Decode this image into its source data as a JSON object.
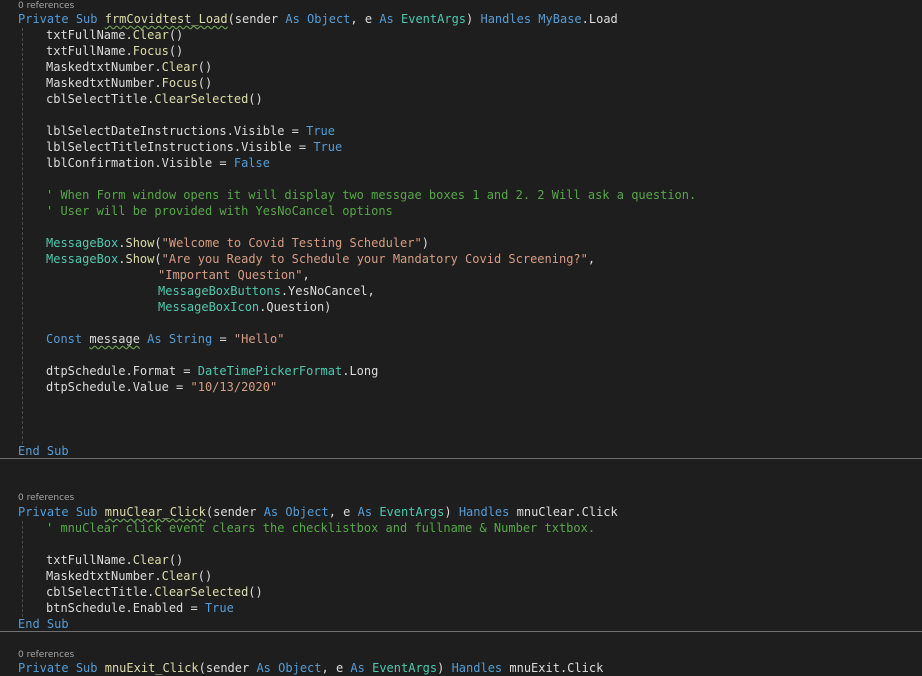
{
  "lenses": {
    "load": "0 references",
    "clear": "0 references",
    "exit": "0 references"
  },
  "load_sub": {
    "kw_private": "Private",
    "kw_sub": "Sub",
    "name": "frmCovidtest_Load",
    "p1": "(sender ",
    "kw_as1": "As",
    "ty_object": "Object",
    "p2": ", e ",
    "kw_as2": "As",
    "ty_eventargs": "EventArgs",
    "p3": ") ",
    "kw_handles": "Handles",
    "kw_mybase": "MyBase",
    "p4": ".Load"
  },
  "load_body": {
    "l1_obj": "txtFullName.",
    "l1_fn": "Clear",
    "l1_end": "()",
    "l2_obj": "txtFullName.",
    "l2_fn": "Focus",
    "l2_end": "()",
    "l3_obj": "MaskedtxtNumber.",
    "l3_fn": "Clear",
    "l3_end": "()",
    "l4_obj": "MaskedtxtNumber.",
    "l4_fn": "Focus",
    "l4_end": "()",
    "l5_obj": "cblSelectTitle.",
    "l5_fn": "ClearSelected",
    "l5_end": "()",
    "l6_text": "lblSelectDateInstructions.Visible = ",
    "l6_val": "True",
    "l7_text": "lblSelectTitleInstructions.Visible = ",
    "l7_val": "True",
    "l8_text": "lblConfirmation.Visible = ",
    "l8_val": "False",
    "comment1": "' When Form window opens it will display two messgae boxes 1 and 2. 2 Will ask a question.",
    "comment2": "' User will be provided with YesNoCancel options",
    "mb1_type": "MessageBox",
    "mb1_dot": ".",
    "mb1_fn": "Show",
    "mb1_open": "(",
    "mb1_str": "\"Welcome to Covid Testing Scheduler\"",
    "mb1_close": ")",
    "mb2_type": "MessageBox",
    "mb2_dot": ".",
    "mb2_fn": "Show",
    "mb2_open": "(",
    "mb2_str": "\"Are you Ready to Schedule your Mandatory Covid Screening?\"",
    "mb2_comma": ",",
    "mb2_arg2": "\"Important Question\"",
    "mb2_arg2_comma": ",",
    "mb2_arg3_type": "MessageBoxButtons",
    "mb2_arg3_rest": ".YesNoCancel,",
    "mb2_arg4_type": "MessageBoxIcon",
    "mb2_arg4_rest": ".Question)",
    "const_kw": "Const",
    "const_name": "message",
    "const_as": "As",
    "const_type": "String",
    "const_eq": " = ",
    "const_val": "\"Hello\"",
    "dtp1_text": "dtpSchedule.Format = ",
    "dtp1_type": "DateTimePickerFormat",
    "dtp1_rest": ".Long",
    "dtp2_text": "dtpSchedule.Value = ",
    "dtp2_val": "\"10/13/2020\"",
    "end_sub": "End Sub"
  },
  "clear_sub": {
    "kw_private": "Private",
    "kw_sub": "Sub",
    "name": "mnuClear_Click",
    "p1": "(sender ",
    "kw_as1": "As",
    "ty_object": "Object",
    "p2": ", e ",
    "kw_as2": "As",
    "ty_eventargs": "EventArgs",
    "p3": ") ",
    "kw_handles": "Handles",
    "p4": " mnuClear.Click",
    "comment": "' mnuClear click event clears the checklistbox and fullname & Number txtbox.",
    "l1_obj": "txtFullName.",
    "l1_fn": "Clear",
    "l1_end": "()",
    "l2_obj": "MaskedtxtNumber.",
    "l2_fn": "Clear",
    "l2_end": "()",
    "l3_obj": "cblSelectTitle.",
    "l3_fn": "ClearSelected",
    "l3_end": "()",
    "l4_text": "btnSchedule.Enabled = ",
    "l4_val": "True",
    "end_sub": "End Sub"
  },
  "exit_sub": {
    "kw_private": "Private",
    "kw_sub": "Sub",
    "name": "mnuExit_Click",
    "p1": "(sender ",
    "kw_as1": "As",
    "ty_object": "Object",
    "p2": ", e ",
    "kw_as2": "As",
    "ty_eventargs": "EventArgs",
    "p3": ") ",
    "kw_handles": "Handles",
    "p4": " mnuExit.Click"
  },
  "colors": {
    "background": "#1e1e1e",
    "keyword": "#569cd6",
    "type": "#4ec9b0",
    "method": "#dcdcaa",
    "string": "#d69d85",
    "comment": "#57a64a",
    "text": "#dcdcdc"
  }
}
